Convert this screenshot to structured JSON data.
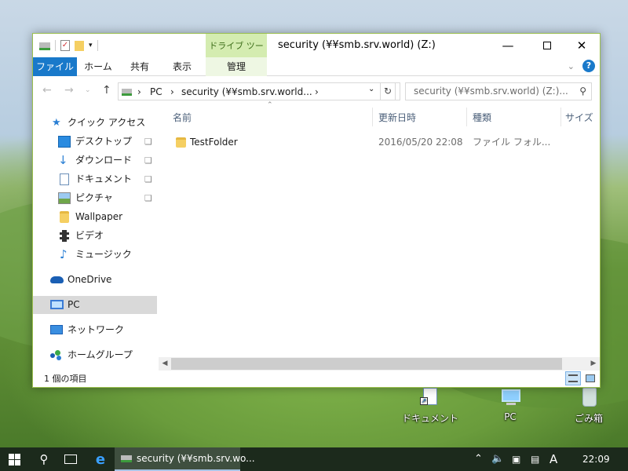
{
  "window": {
    "title": "security (¥¥smb.srv.world) (Z:)",
    "context_tab_group": "ドライブ ツール"
  },
  "ribbon": {
    "tabs": [
      "ファイル",
      "ホーム",
      "共有",
      "表示",
      "管理"
    ]
  },
  "address": {
    "segments": [
      "PC",
      "security (¥¥smb.srv.world..."
    ],
    "search_placeholder": "security (¥¥smb.srv.world) (Z:)..."
  },
  "nav": {
    "quick_access": "クイック アクセス",
    "items": [
      "デスクトップ",
      "ダウンロード",
      "ドキュメント",
      "ピクチャ",
      "Wallpaper",
      "ビデオ",
      "ミュージック"
    ],
    "onedrive": "OneDrive",
    "pc": "PC",
    "network": "ネットワーク",
    "homegroup": "ホームグループ"
  },
  "columns": [
    "名前",
    "更新日時",
    "種類",
    "サイズ"
  ],
  "files": [
    {
      "name": "TestFolder",
      "modified": "2016/05/20 22:08",
      "type": "ファイル フォル..."
    }
  ],
  "status": {
    "item_count": "1 個の項目"
  },
  "desktop_icons": [
    "ドキュメント",
    "PC",
    "ごみ箱"
  ],
  "taskbar": {
    "app_label": "security (¥¥smb.srv.wo...",
    "ime": "A",
    "clock": "22:09"
  },
  "colors": {
    "accent": "#1979ca",
    "context_tab": "#d4ecb0",
    "taskbar": "#1c2a1c"
  }
}
